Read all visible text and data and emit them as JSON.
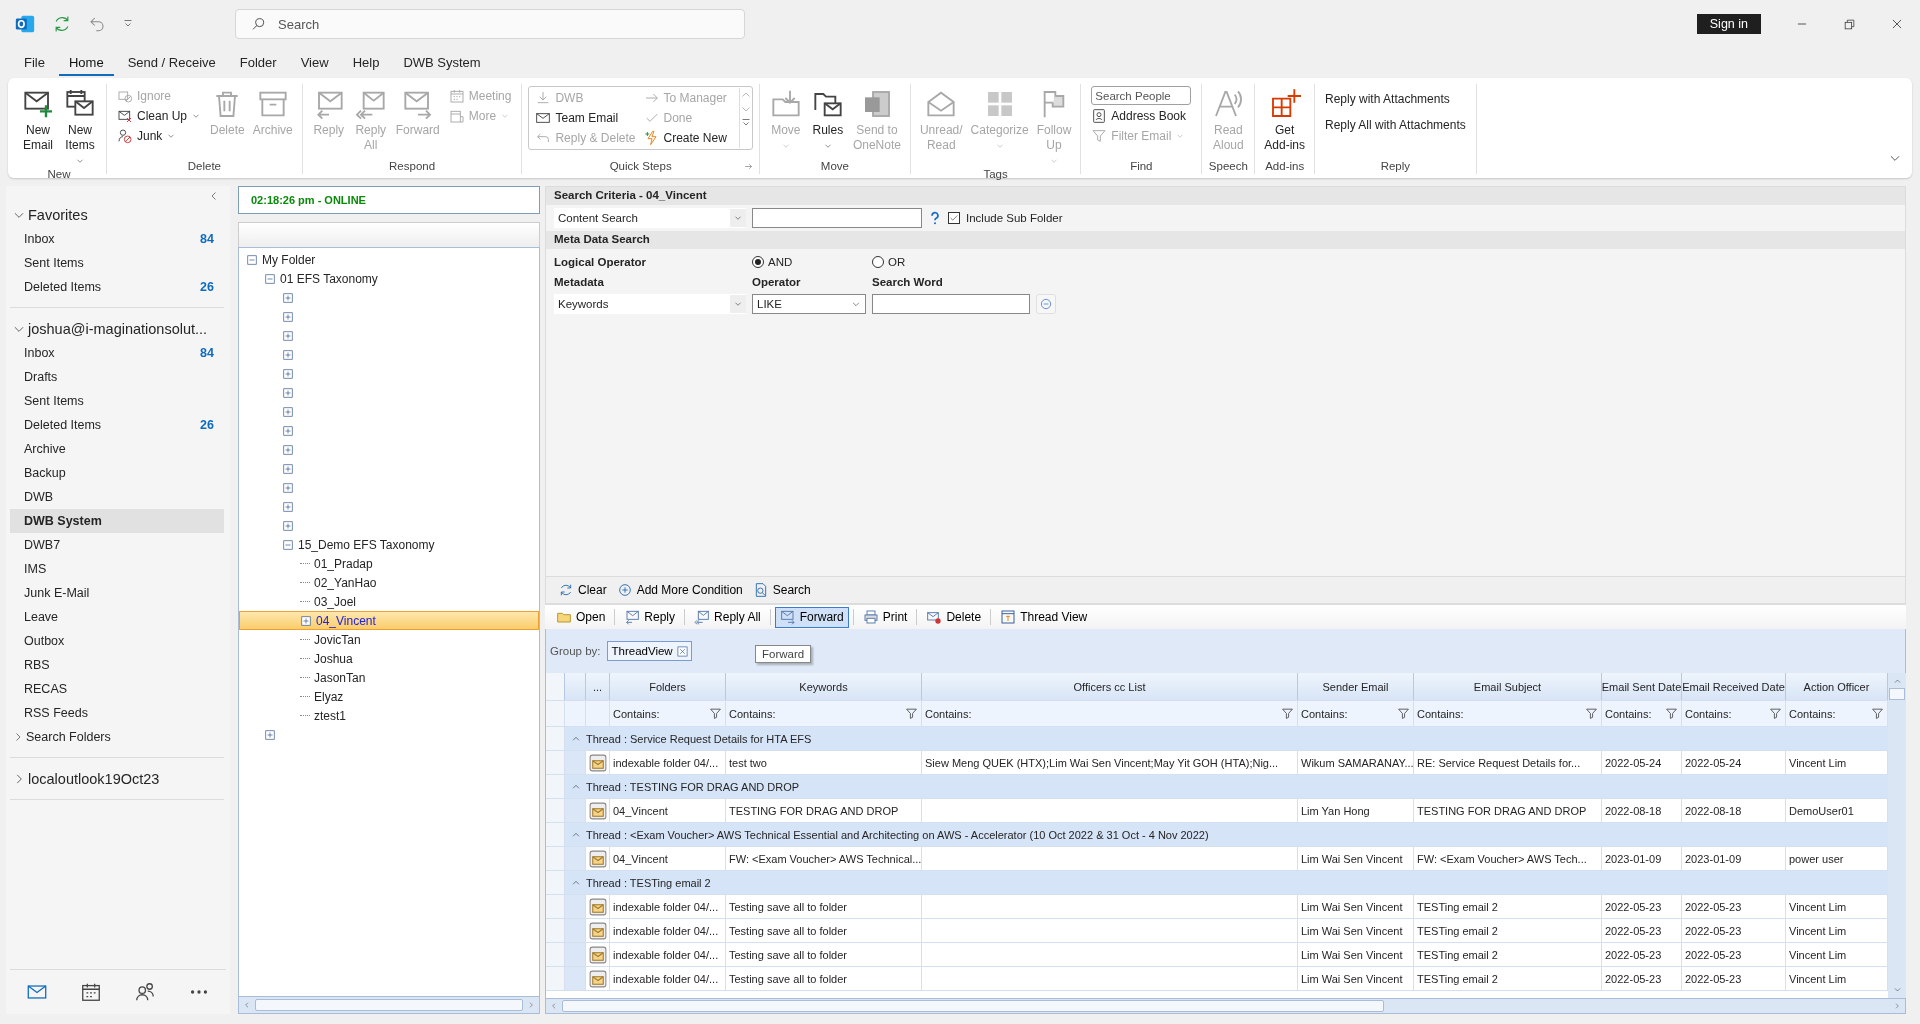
{
  "title_bar": {
    "search": {
      "placeholder": "Search"
    },
    "sign_in": "Sign in"
  },
  "menu_tabs": [
    {
      "label": "File",
      "selected": false
    },
    {
      "label": "Home",
      "selected": true
    },
    {
      "label": "Send / Receive",
      "selected": false
    },
    {
      "label": "Folder",
      "selected": false
    },
    {
      "label": "View",
      "selected": false
    },
    {
      "label": "Help",
      "selected": false
    },
    {
      "label": "DWB System",
      "selected": false
    }
  ],
  "ribbon": {
    "groups": [
      {
        "title": "New",
        "kind": "plain",
        "launcher": false,
        "columns": [
          {
            "items": [
              {
                "kind": "large",
                "label": "New\nEmail",
                "disabled": false,
                "dropdown": false
              }
            ]
          },
          {
            "items": [
              {
                "kind": "large",
                "label": "New\nItems",
                "disabled": false,
                "dropdown": true
              }
            ]
          }
        ]
      },
      {
        "title": "Delete",
        "kind": "plain",
        "launcher": false,
        "columns": [
          {
            "items": [
              {
                "kind": "small",
                "label": "Ignore",
                "disabled": true,
                "dropdown": false
              },
              {
                "kind": "small",
                "label": "Clean Up",
                "disabled": false,
                "dropdown": true
              },
              {
                "kind": "small",
                "label": "Junk",
                "disabled": false,
                "dropdown": true
              }
            ]
          },
          {
            "items": [
              {
                "kind": "large",
                "label": "Delete",
                "disabled": true,
                "dropdown": false
              }
            ]
          },
          {
            "items": [
              {
                "kind": "large",
                "label": "Archive",
                "disabled": true,
                "dropdown": false
              }
            ]
          }
        ]
      },
      {
        "title": "Respond",
        "kind": "plain",
        "launcher": false,
        "columns": [
          {
            "items": [
              {
                "kind": "large",
                "label": "Reply",
                "disabled": true,
                "dropdown": false
              }
            ]
          },
          {
            "items": [
              {
                "kind": "large",
                "label": "Reply\nAll",
                "disabled": true,
                "dropdown": false
              }
            ]
          },
          {
            "items": [
              {
                "kind": "large",
                "label": "Forward",
                "disabled": true,
                "dropdown": false
              }
            ]
          },
          {
            "items": [
              {
                "kind": "small",
                "label": "Meeting",
                "disabled": true,
                "dropdown": false
              },
              {
                "kind": "small",
                "label": "More",
                "disabled": true,
                "dropdown": true
              }
            ]
          }
        ]
      },
      {
        "title": "Quick Steps",
        "kind": "gallery",
        "launcher": true,
        "columns": [
          {
            "items": [
              {
                "kind": "small",
                "label": "DWB",
                "disabled": true,
                "dropdown": false
              },
              {
                "kind": "small",
                "label": "Team Email",
                "disabled": false,
                "dropdown": false
              },
              {
                "kind": "small",
                "label": "Reply & Delete",
                "disabled": true,
                "dropdown": false
              }
            ]
          },
          {
            "items": [
              {
                "kind": "small",
                "label": "To Manager",
                "disabled": true,
                "dropdown": false
              },
              {
                "kind": "small",
                "label": "Done",
                "disabled": true,
                "dropdown": false
              },
              {
                "kind": "small",
                "label": "Create New",
                "disabled": false,
                "dropdown": false
              }
            ]
          }
        ]
      },
      {
        "title": "Move",
        "kind": "plain",
        "launcher": false,
        "columns": [
          {
            "items": [
              {
                "kind": "large",
                "label": "Move",
                "disabled": true,
                "dropdown": true
              }
            ]
          },
          {
            "items": [
              {
                "kind": "large",
                "label": "Rules",
                "disabled": false,
                "dropdown": true
              }
            ]
          },
          {
            "items": [
              {
                "kind": "large",
                "label": "Send to\nOneNote",
                "disabled": true,
                "dropdown": false
              }
            ]
          }
        ]
      },
      {
        "title": "Tags",
        "kind": "plain",
        "launcher": false,
        "columns": [
          {
            "items": [
              {
                "kind": "large",
                "label": "Unread/\nRead",
                "disabled": true,
                "dropdown": false
              }
            ]
          },
          {
            "items": [
              {
                "kind": "large",
                "label": "Categorize",
                "disabled": true,
                "dropdown": true
              }
            ]
          },
          {
            "items": [
              {
                "kind": "large",
                "label": "Follow\nUp",
                "disabled": true,
                "dropdown": true
              }
            ]
          }
        ]
      },
      {
        "title": "Find",
        "kind": "plain",
        "launcher": false,
        "columns": [
          {
            "items": [
              {
                "kind": "field",
                "placeholder": "Search People",
                "disabled": false,
                "dropdown": false
              },
              {
                "kind": "small",
                "label": "Address Book",
                "disabled": false,
                "dropdown": false
              },
              {
                "kind": "small",
                "label": "Filter Email",
                "disabled": true,
                "dropdown": true
              }
            ]
          }
        ]
      },
      {
        "title": "Speech",
        "kind": "plain",
        "launcher": false,
        "columns": [
          {
            "items": [
              {
                "kind": "large",
                "label": "Read\nAloud",
                "disabled": true,
                "dropdown": false
              }
            ]
          }
        ]
      },
      {
        "title": "Add-ins",
        "kind": "plain",
        "launcher": false,
        "columns": [
          {
            "items": [
              {
                "kind": "large",
                "label": "Get\nAdd-ins",
                "disabled": false,
                "dropdown": false
              }
            ]
          }
        ]
      },
      {
        "title": "Reply",
        "kind": "plain",
        "launcher": false,
        "columns": [
          {
            "items": [
              {
                "kind": "text",
                "label": "Reply with Attachments",
                "disabled": false,
                "dropdown": false
              },
              {
                "kind": "text",
                "label": "Reply All with Attachments",
                "disabled": false,
                "dropdown": false
              }
            ]
          }
        ]
      }
    ]
  },
  "nav": {
    "sections": [
      {
        "title": "Favorites",
        "expanded": true,
        "items": [
          {
            "kind": "folder",
            "label": "Inbox",
            "count": "84",
            "selected": false
          },
          {
            "kind": "folder",
            "label": "Sent Items",
            "selected": false
          },
          {
            "kind": "folder",
            "label": "Deleted Items",
            "count": "26",
            "selected": false
          }
        ]
      },
      {
        "title": "joshua@i-maginationsolut...",
        "expanded": true,
        "items": [
          {
            "kind": "folder",
            "label": "Inbox",
            "count": "84",
            "selected": false
          },
          {
            "kind": "folder",
            "label": "Drafts",
            "selected": false
          },
          {
            "kind": "folder",
            "label": "Sent Items",
            "selected": false
          },
          {
            "kind": "folder",
            "label": "Deleted Items",
            "count": "26",
            "selected": false
          },
          {
            "kind": "folder",
            "label": "Archive",
            "selected": false
          },
          {
            "kind": "folder",
            "label": "Backup",
            "selected": false
          },
          {
            "kind": "folder",
            "label": "DWB",
            "selected": false
          },
          {
            "kind": "folder",
            "label": "DWB System",
            "selected": true
          },
          {
            "kind": "folder",
            "label": "DWB7",
            "selected": false
          },
          {
            "kind": "folder",
            "label": "IMS",
            "selected": false
          },
          {
            "kind": "folder",
            "label": "Junk E-Mail",
            "selected": false
          },
          {
            "kind": "folder",
            "label": "Leave",
            "selected": false
          },
          {
            "kind": "folder",
            "label": "Outbox",
            "selected": false
          },
          {
            "kind": "folder",
            "label": "RBS",
            "selected": false
          },
          {
            "kind": "folder",
            "label": "RECAS",
            "selected": false
          },
          {
            "kind": "folder",
            "label": "RSS Feeds",
            "selected": false
          },
          {
            "kind": "group",
            "label": "Search Folders",
            "selected": false
          }
        ]
      },
      {
        "title": "localoutlook19Oct23",
        "expanded": false
      }
    ],
    "modules": [
      {
        "selected": true
      },
      {
        "selected": false
      },
      {
        "selected": false
      },
      {
        "selected": false
      }
    ]
  },
  "tree": {
    "status": "02:18:26 pm - ONLINE",
    "nodes": [
      {
        "label": "My Folder",
        "expanded": true,
        "selected": false,
        "children": [
          {
            "label": "01 EFS Taxonomy",
            "expanded": true,
            "selected": false,
            "children": [
              {
                "expanded": false,
                "selected": false
              },
              {
                "expanded": false,
                "selected": false
              },
              {
                "expanded": false,
                "selected": false
              },
              {
                "expanded": false,
                "selected": false
              },
              {
                "expanded": false,
                "selected": false
              },
              {
                "expanded": false,
                "selected": false
              },
              {
                "expanded": false,
                "selected": false
              },
              {
                "expanded": false,
                "selected": false
              },
              {
                "expanded": false,
                "selected": false
              },
              {
                "expanded": false,
                "selected": false
              },
              {
                "expanded": false,
                "selected": false
              },
              {
                "expanded": false,
                "selected": false
              },
              {
                "expanded": false,
                "selected": false
              },
              {
                "label": "15_Demo EFS Taxonomy",
                "expanded": true,
                "selected": false,
                "children": [
                  {
                    "label": "01_Pradap",
                    "selected": false
                  },
                  {
                    "label": "02_YanHao",
                    "selected": false
                  },
                  {
                    "label": "03_Joel",
                    "selected": false
                  },
                  {
                    "label": "04_Vincent",
                    "expanded": false,
                    "selected": true
                  },
                  {
                    "label": "JovicTan",
                    "selected": false
                  },
                  {
                    "label": "Joshua",
                    "selected": false
                  },
                  {
                    "label": "JasonTan",
                    "selected": false
                  },
                  {
                    "label": "Elyaz",
                    "selected": false
                  },
                  {
                    "label": "ztest1",
                    "selected": false
                  }
                ]
              }
            ]
          },
          {
            "expanded": false,
            "selected": false
          }
        ]
      }
    ]
  },
  "search": {
    "title": "Search Criteria - 04_Vincent",
    "content_search": "Content Search",
    "include_sub_folder": {
      "label": "Include Sub Folder",
      "checked": true
    },
    "meta_title": "Meta Data Search",
    "logical_operator": {
      "label": "Logical Operator",
      "options": [
        {
          "label": "AND",
          "selected": true
        },
        {
          "label": "OR",
          "selected": false
        }
      ]
    },
    "columns": [
      "Metadata",
      "Operator",
      "Search Word"
    ],
    "conditions": [
      {
        "metadata": "Keywords",
        "operator": "LIKE"
      }
    ],
    "actions": [
      "Clear",
      "Add More Condition",
      "Search"
    ]
  },
  "results": {
    "toolbar": [
      {
        "label": "Open",
        "hovered": false
      },
      {
        "label": "Reply",
        "hovered": false
      },
      {
        "label": "Reply All",
        "hovered": false
      },
      {
        "label": "Forward",
        "hovered": true
      },
      {
        "label": "Print",
        "hovered": false
      },
      {
        "label": "Delete",
        "hovered": false
      },
      {
        "label": "Thread View",
        "hovered": false
      }
    ],
    "tooltip": "Forward",
    "group_by": {
      "label": "Group by:",
      "chip": "ThreadView"
    },
    "columns": [
      "...",
      "Folders",
      "Keywords",
      "Officers cc List",
      "Sender Email",
      "Email Subject",
      "Email Sent Date",
      "Email Received Date",
      "Action Officer"
    ],
    "filters": [
      "Contains:",
      "Contains:",
      "Contains:",
      "Contains:",
      "Contains:",
      "Contains:",
      "Contains:",
      "Contains:"
    ],
    "threads": [
      {
        "title": "Thread : Service Request Details for HTA EFS",
        "expanded": true,
        "rows": [
          {
            "cells": [
              "indexable folder 04/...",
              "test two",
              "Siew Meng QUEK (HTX);Lim Wai Sen Vincent;May Yit GOH (HTA);Nig...",
              "Wikum SAMARANAY...",
              "RE: Service Request Details for...",
              "2022-05-24",
              "2022-05-24",
              "Vincent Lim"
            ]
          }
        ]
      },
      {
        "title": "Thread : TESTING FOR DRAG AND DROP",
        "expanded": true,
        "rows": [
          {
            "cells": [
              "04_Vincent",
              "TESTING FOR DRAG AND DROP",
              null,
              "Lim Yan Hong",
              "TESTING FOR DRAG AND DROP",
              "2022-08-18",
              "2022-08-18",
              "DemoUser01"
            ]
          }
        ]
      },
      {
        "title": "Thread : <Exam Voucher> AWS Technical Essential and Architecting on AWS - Accelerator (10 Oct 2022 & 31 Oct - 4 Nov 2022)",
        "expanded": true,
        "rows": [
          {
            "cells": [
              "04_Vincent",
              "FW: <Exam Voucher> AWS Technical...",
              null,
              "Lim Wai Sen Vincent",
              "FW: <Exam Voucher> AWS Tech...",
              "2023-01-09",
              "2023-01-09",
              "power user"
            ]
          }
        ]
      },
      {
        "title": "Thread : TESTing email 2",
        "expanded": true,
        "rows": [
          {
            "cells": [
              "indexable folder 04/...",
              "Testing save all to folder",
              null,
              "Lim Wai Sen Vincent",
              "TESTing email 2",
              "2022-05-23",
              "2022-05-23",
              "Vincent Lim"
            ]
          },
          {
            "cells": [
              "indexable folder 04/...",
              "Testing save all to folder",
              null,
              "Lim Wai Sen Vincent",
              "TESTing email 2",
              "2022-05-23",
              "2022-05-23",
              "Vincent Lim"
            ]
          },
          {
            "cells": [
              "indexable folder 04/...",
              "Testing save all to folder",
              null,
              "Lim Wai Sen Vincent",
              "TESTing email 2",
              "2022-05-23",
              "2022-05-23",
              "Vincent Lim"
            ]
          },
          {
            "cells": [
              "indexable folder 04/...",
              "Testing save all to folder",
              null,
              "Lim Wai Sen Vincent",
              "TESTing email 2",
              "2022-05-23",
              "2022-05-23",
              "Vincent Lim"
            ]
          }
        ]
      }
    ]
  }
}
